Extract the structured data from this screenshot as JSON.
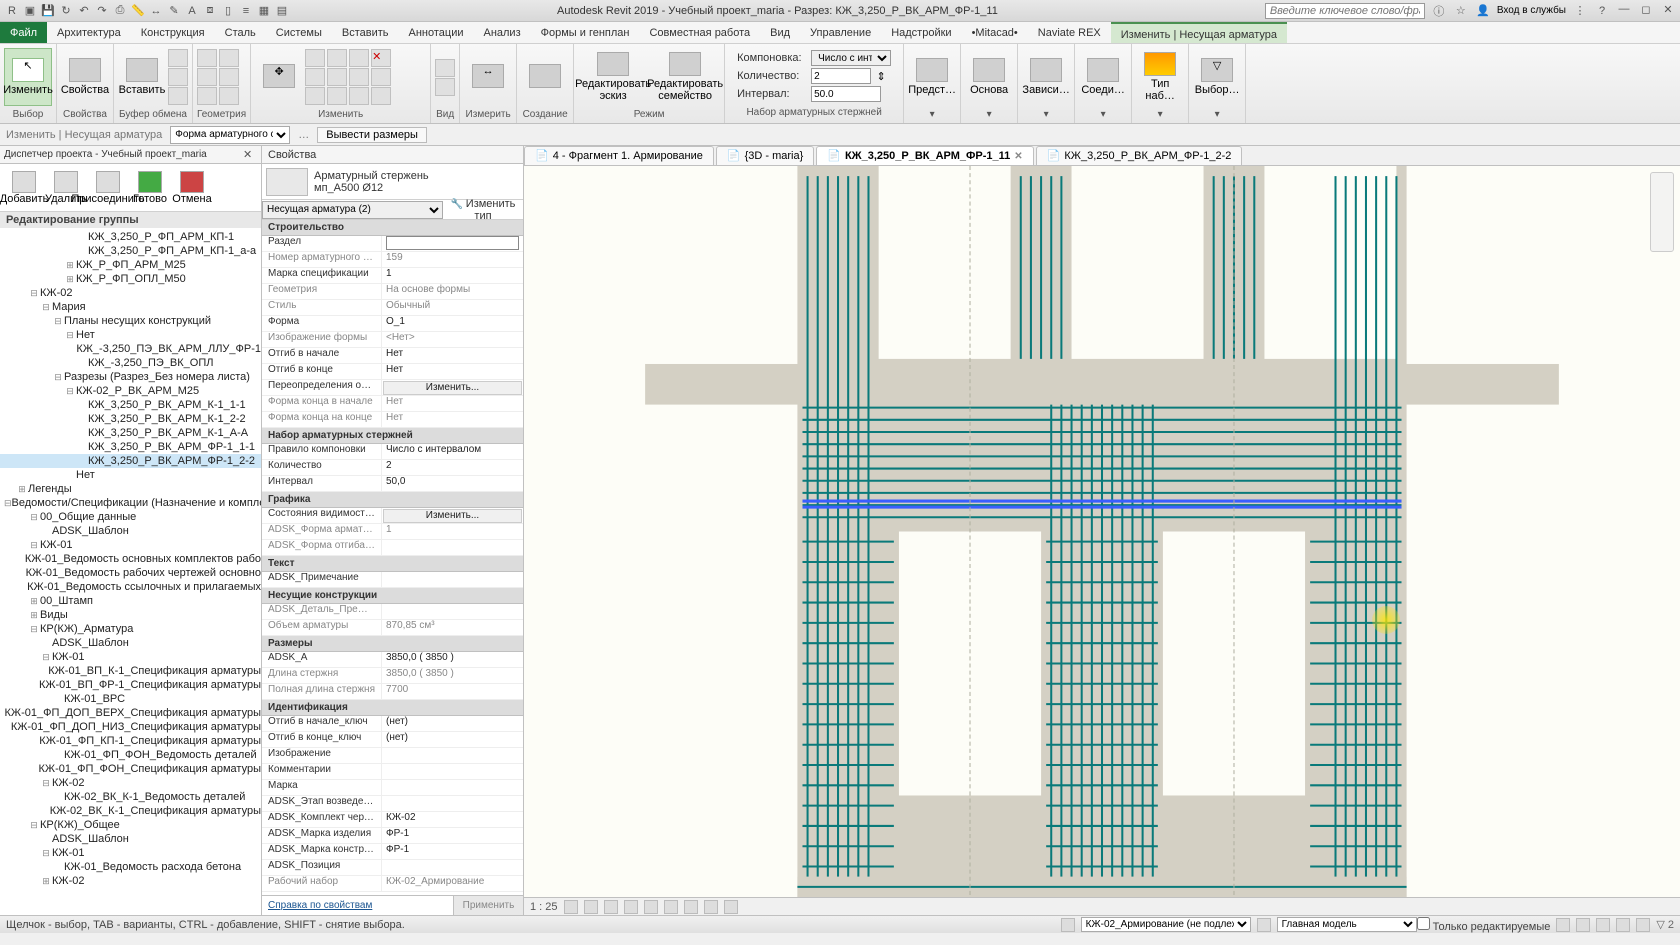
{
  "app": {
    "title": "Autodesk Revit 2019 - Учебный проект_maria - Разрез: КЖ_3,250_Р_ВК_АРМ_ФР-1_11",
    "search_placeholder": "Введите ключевое слово/фразу",
    "login": "Вход в службы"
  },
  "ribbon": {
    "tabs": [
      "Файл",
      "Архитектура",
      "Конструкция",
      "Сталь",
      "Системы",
      "Вставить",
      "Аннотации",
      "Анализ",
      "Формы и генплан",
      "Совместная работа",
      "Вид",
      "Управление",
      "Надстройки",
      "•Mitacad•",
      "Naviate REX",
      "Изменить | Несущая арматура"
    ],
    "active_tab": 15,
    "panels": {
      "select": "Выбор",
      "props": "Свойства",
      "clipboard": "Буфер обмена",
      "geom": "Геометрия",
      "modify": "Изменить",
      "view": "Вид",
      "measure": "Измерить",
      "create": "Создание",
      "mode": "Режим",
      "rebar_set": "Набор арматурных стержней"
    },
    "modify_btn": "Изменить",
    "props_btn": "Свойства",
    "paste_btn": "Вставить",
    "edit_sketch": "Редактировать\nэскиз",
    "edit_family": "Редактировать\nсемейство",
    "preview": "Предст…",
    "host": "Основа",
    "depend": "Зависи…",
    "connect": "Соеди…",
    "cover_type": "Тип наб…",
    "select_btn": "Выбор…",
    "layout_label": "Компоновка:",
    "layout_val": "Число с инт…",
    "qty_label": "Количество:",
    "qty_val": "2",
    "spacing_label": "Интервал:",
    "spacing_val": "50.0"
  },
  "options_bar": {
    "context": "Изменить | Несущая арматура",
    "shape_label": "Форма арматурного сте",
    "dims_btn": "Вывести размеры"
  },
  "project_browser": {
    "title": "Диспетчер проекта - Учебный проект_maria",
    "tools": [
      "Добавить",
      "Удалить",
      "Присоединить",
      "Готово",
      "Отмена"
    ],
    "group_header": "Редактирование группы",
    "tree": [
      {
        "indent": 6,
        "exp": "",
        "label": "КЖ_3,250_Р_ФП_АРМ_КП-1"
      },
      {
        "indent": 6,
        "exp": "",
        "label": "КЖ_3,250_Р_ФП_АРМ_КП-1_а-а"
      },
      {
        "indent": 5,
        "exp": "⊞",
        "label": "КЖ_Р_ФП_АРМ_М25"
      },
      {
        "indent": 5,
        "exp": "⊞",
        "label": "КЖ_Р_ФП_ОПЛ_М50"
      },
      {
        "indent": 2,
        "exp": "⊟",
        "label": "КЖ-02"
      },
      {
        "indent": 3,
        "exp": "⊟",
        "label": "Мария"
      },
      {
        "indent": 4,
        "exp": "⊟",
        "label": "Планы несущих конструкций"
      },
      {
        "indent": 5,
        "exp": "⊟",
        "label": "Нет"
      },
      {
        "indent": 6,
        "exp": "",
        "label": "КЖ_-3,250_ПЭ_ВК_АРМ_ЛЛУ_ФР-1"
      },
      {
        "indent": 6,
        "exp": "",
        "label": "КЖ_-3,250_ПЭ_ВК_ОПЛ"
      },
      {
        "indent": 4,
        "exp": "⊟",
        "label": "Разрезы (Разрез_Без номера листа)"
      },
      {
        "indent": 5,
        "exp": "⊟",
        "label": "КЖ-02_Р_ВК_АРМ_М25"
      },
      {
        "indent": 6,
        "exp": "",
        "label": "КЖ_3,250_Р_ВК_АРМ_К-1_1-1"
      },
      {
        "indent": 6,
        "exp": "",
        "label": "КЖ_3,250_Р_ВК_АРМ_К-1_2-2"
      },
      {
        "indent": 6,
        "exp": "",
        "label": "КЖ_3,250_Р_ВК_АРМ_К-1_А-А"
      },
      {
        "indent": 6,
        "exp": "",
        "label": "КЖ_3,250_Р_ВК_АРМ_ФР-1_1-1"
      },
      {
        "indent": 6,
        "exp": "",
        "label": "КЖ_3,250_Р_ВК_АРМ_ФР-1_2-2",
        "sel": true
      },
      {
        "indent": 5,
        "exp": "",
        "label": "Нет"
      },
      {
        "indent": 1,
        "exp": "⊞",
        "label": "Легенды"
      },
      {
        "indent": 1,
        "exp": "⊟",
        "label": "Ведомости/Спецификации (Назначение и комплект)"
      },
      {
        "indent": 2,
        "exp": "⊟",
        "label": "00_Общие данные"
      },
      {
        "indent": 3,
        "exp": "",
        "label": "ADSK_Шаблон"
      },
      {
        "indent": 2,
        "exp": "⊟",
        "label": "КЖ-01"
      },
      {
        "indent": 3,
        "exp": "",
        "label": "КЖ-01_Ведомость основных комплектов рабо"
      },
      {
        "indent": 3,
        "exp": "",
        "label": "КЖ-01_Ведомость рабочих чертежей основно"
      },
      {
        "indent": 3,
        "exp": "",
        "label": "КЖ-01_Ведомость ссылочных и прилагаемых"
      },
      {
        "indent": 2,
        "exp": "⊞",
        "label": "00_Штамп"
      },
      {
        "indent": 2,
        "exp": "⊞",
        "label": "Виды"
      },
      {
        "indent": 2,
        "exp": "⊟",
        "label": "КР(КЖ)_Арматура"
      },
      {
        "indent": 3,
        "exp": "",
        "label": "ADSK_Шаблон"
      },
      {
        "indent": 3,
        "exp": "⊟",
        "label": "КЖ-01"
      },
      {
        "indent": 4,
        "exp": "",
        "label": "КЖ-01_ВП_К-1_Спецификация арматуры"
      },
      {
        "indent": 4,
        "exp": "",
        "label": "КЖ-01_ВП_ФР-1_Спецификация арматуры"
      },
      {
        "indent": 4,
        "exp": "",
        "label": "КЖ-01_ВРС"
      },
      {
        "indent": 4,
        "exp": "",
        "label": "КЖ-01_ФП_ДОП_ВЕРХ_Спецификация арматуры"
      },
      {
        "indent": 4,
        "exp": "",
        "label": "КЖ-01_ФП_ДОП_НИЗ_Спецификация арматуры"
      },
      {
        "indent": 4,
        "exp": "",
        "label": "КЖ-01_ФП_КП-1_Спецификация арматуры"
      },
      {
        "indent": 4,
        "exp": "",
        "label": "КЖ-01_ФП_ФОН_Ведомость деталей"
      },
      {
        "indent": 4,
        "exp": "",
        "label": "КЖ-01_ФП_ФОН_Спецификация арматуры"
      },
      {
        "indent": 3,
        "exp": "⊟",
        "label": "КЖ-02"
      },
      {
        "indent": 4,
        "exp": "",
        "label": "КЖ-02_ВК_К-1_Ведомость деталей"
      },
      {
        "indent": 4,
        "exp": "",
        "label": "КЖ-02_ВК_К-1_Спецификация арматуры"
      },
      {
        "indent": 2,
        "exp": "⊟",
        "label": "КР(КЖ)_Общее"
      },
      {
        "indent": 3,
        "exp": "",
        "label": "ADSK_Шаблон"
      },
      {
        "indent": 3,
        "exp": "⊟",
        "label": "КЖ-01"
      },
      {
        "indent": 4,
        "exp": "",
        "label": "КЖ-01_Ведомость расхода бетона"
      },
      {
        "indent": 3,
        "exp": "⊞",
        "label": "КЖ-02"
      }
    ]
  },
  "properties": {
    "header": "Свойства",
    "type_name": "Арматурный стержень",
    "type_sub": "мп_А500 Ø12",
    "filter": "Несущая арматура (2)",
    "edit_type": "Изменить тип",
    "cats": [
      {
        "name": "Строительство",
        "rows": [
          {
            "n": "Раздел",
            "v": "",
            "editable": true
          },
          {
            "n": "Номер арматурного стерж…",
            "v": "159",
            "ro": true
          },
          {
            "n": "Марка спецификации",
            "v": "1"
          },
          {
            "n": "Геометрия",
            "v": "На основе формы",
            "ro": true
          },
          {
            "n": "Стиль",
            "v": "Обычный",
            "ro": true
          },
          {
            "n": "Форма",
            "v": "О_1"
          },
          {
            "n": "Изображение формы",
            "v": "<Нет>",
            "ro": true
          },
          {
            "n": "Отгиб в начале",
            "v": "Нет"
          },
          {
            "n": "Отгиб в конце",
            "v": "Нет"
          },
          {
            "n": "Переопределения округле…",
            "v": "Изменить...",
            "btn": true
          },
          {
            "n": "Форма конца в начале",
            "v": "Нет",
            "ro": true
          },
          {
            "n": "Форма конца на конце",
            "v": "Нет",
            "ro": true
          }
        ]
      },
      {
        "name": "Набор арматурных стержней",
        "rows": [
          {
            "n": "Правило компоновки",
            "v": "Число с интервалом"
          },
          {
            "n": "Количество",
            "v": "2"
          },
          {
            "n": "Интервал",
            "v": "50,0"
          }
        ]
      },
      {
        "name": "Графика",
        "rows": [
          {
            "n": "Состояния видимости вида",
            "v": "Изменить...",
            "btn": true
          },
          {
            "n": "ADSK_Форма арматуры",
            "v": "1",
            "ro": true
          },
          {
            "n": "ADSK_Форма отгибами",
            "v": "",
            "ro": true
          }
        ]
      },
      {
        "name": "Текст",
        "rows": [
          {
            "n": "ADSK_Примечание",
            "v": ""
          }
        ]
      },
      {
        "name": "Несущие конструкции",
        "rows": [
          {
            "n": "ADSK_Деталь_Префикс",
            "v": "",
            "ro": true
          },
          {
            "n": "Объем арматуры",
            "v": "870,85 см³",
            "ro": true
          }
        ]
      },
      {
        "name": "Размеры",
        "rows": [
          {
            "n": "ADSK_А",
            "v": "3850,0 ( 3850 )"
          },
          {
            "n": "Длина стержня",
            "v": "3850,0 ( 3850 )",
            "ro": true
          },
          {
            "n": "Полная длина стержня",
            "v": "7700",
            "ro": true
          }
        ]
      },
      {
        "name": "Идентификация",
        "rows": [
          {
            "n": "Отгиб в начале_ключ",
            "v": "(нет)"
          },
          {
            "n": "Отгиб в конце_ключ",
            "v": "(нет)"
          },
          {
            "n": "Изображение",
            "v": ""
          },
          {
            "n": "Комментарии",
            "v": ""
          },
          {
            "n": "Марка",
            "v": ""
          },
          {
            "n": "ADSK_Этап возведения",
            "v": ""
          },
          {
            "n": "ADSK_Комплект чертежей",
            "v": "КЖ-02"
          },
          {
            "n": "ADSK_Марка изделия",
            "v": "ФР-1"
          },
          {
            "n": "ADSK_Марка конструкции",
            "v": "ФР-1"
          },
          {
            "n": "ADSK_Позиция",
            "v": ""
          },
          {
            "n": "Рабочий набор",
            "v": "КЖ-02_Армирование",
            "ro": true
          }
        ]
      }
    ],
    "help_link": "Справка по свойствам",
    "apply": "Применить"
  },
  "view_tabs": [
    {
      "label": "4 - Фрагмент 1. Армирование",
      "active": false
    },
    {
      "label": "{3D - maria}",
      "active": false
    },
    {
      "label": "КЖ_3,250_Р_ВК_АРМ_ФР-1_11",
      "active": true
    },
    {
      "label": "КЖ_3,250_Р_ВК_АРМ_ФР-1_2-2",
      "active": false
    }
  ],
  "view_controls": {
    "scale": "1 : 25"
  },
  "status": {
    "hint": "Щелчок - выбор, TAB - варианты, CTRL - добавление, SHIFT - снятие выбора.",
    "workset": "КЖ-02_Армирование (не подлеж",
    "model_label": "Главная модель",
    "editable_only": "Только редактируемые"
  }
}
